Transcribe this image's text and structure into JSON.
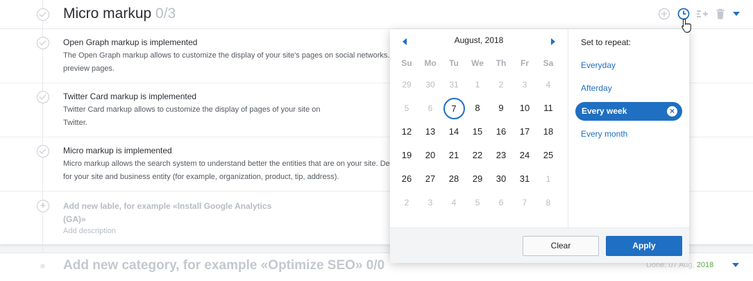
{
  "category": {
    "title": "Micro markup",
    "count": "0/3"
  },
  "tasks": [
    {
      "title": "Open Graph markup is implemented",
      "desc1": "The Open Graph markup allows to customize the display of your site's pages on social networks.",
      "desc2": "preview pages."
    },
    {
      "title": "Twitter Card markup is implemented",
      "desc1": "Twitter Card markup allows to customize the display of pages of your site on",
      "desc2": "Twitter."
    },
    {
      "title": "Micro markup is implemented",
      "desc1": "Micro markup allows the search system to understand better the entities that are on your site. De",
      "desc2": "for your site and business entity (for example, organization, product, tip, address)."
    }
  ],
  "new_task": {
    "title_line1": "Add new lable, for example «Install Google Analytics",
    "title_line2": "(GA)»",
    "desc": "Add description"
  },
  "new_category": {
    "title": "Add new category, for example «Optimize SEO»",
    "count": "0/0",
    "done_label": "Done: 07 Aug,",
    "done_year": "2018"
  },
  "calendar": {
    "month": "August, 2018",
    "weekdays": [
      "Su",
      "Mo",
      "Tu",
      "We",
      "Th",
      "Fr",
      "Sa"
    ],
    "weeks": [
      [
        {
          "d": "29",
          "o": true
        },
        {
          "d": "30",
          "o": true
        },
        {
          "d": "31",
          "o": true
        },
        {
          "d": "1",
          "o": true
        },
        {
          "d": "2",
          "o": true
        },
        {
          "d": "3",
          "o": true
        },
        {
          "d": "4",
          "o": true
        }
      ],
      [
        {
          "d": "5",
          "o": true
        },
        {
          "d": "6",
          "o": true
        },
        {
          "d": "7",
          "sel": true
        },
        {
          "d": "8"
        },
        {
          "d": "9"
        },
        {
          "d": "10"
        },
        {
          "d": "11"
        }
      ],
      [
        {
          "d": "12"
        },
        {
          "d": "13"
        },
        {
          "d": "14"
        },
        {
          "d": "15"
        },
        {
          "d": "16"
        },
        {
          "d": "17"
        },
        {
          "d": "18"
        }
      ],
      [
        {
          "d": "19"
        },
        {
          "d": "20"
        },
        {
          "d": "21"
        },
        {
          "d": "22"
        },
        {
          "d": "23"
        },
        {
          "d": "24"
        },
        {
          "d": "25"
        }
      ],
      [
        {
          "d": "26"
        },
        {
          "d": "27"
        },
        {
          "d": "28"
        },
        {
          "d": "29"
        },
        {
          "d": "30"
        },
        {
          "d": "31"
        },
        {
          "d": "1",
          "o": true
        }
      ],
      [
        {
          "d": "2",
          "o": true
        },
        {
          "d": "3",
          "o": true
        },
        {
          "d": "4",
          "o": true
        },
        {
          "d": "5",
          "o": true
        },
        {
          "d": "6",
          "o": true
        },
        {
          "d": "7",
          "o": true
        },
        {
          "d": "8",
          "o": true
        }
      ]
    ]
  },
  "repeat": {
    "label": "Set to repeat:",
    "options": [
      "Everyday",
      "Afterday",
      "Every week",
      "Every month"
    ],
    "selected": "Every week"
  },
  "buttons": {
    "clear": "Clear",
    "apply": "Apply"
  },
  "colors": {
    "accent": "#1f6fc2",
    "done_green": "#5aa846"
  },
  "icons": [
    "check-circle-icon",
    "add-circle-icon",
    "clock-icon",
    "add-subtask-icon",
    "trash-icon",
    "chevron-down-icon",
    "hand-pointer-icon",
    "arrow-left-icon",
    "arrow-right-icon",
    "close-icon"
  ]
}
